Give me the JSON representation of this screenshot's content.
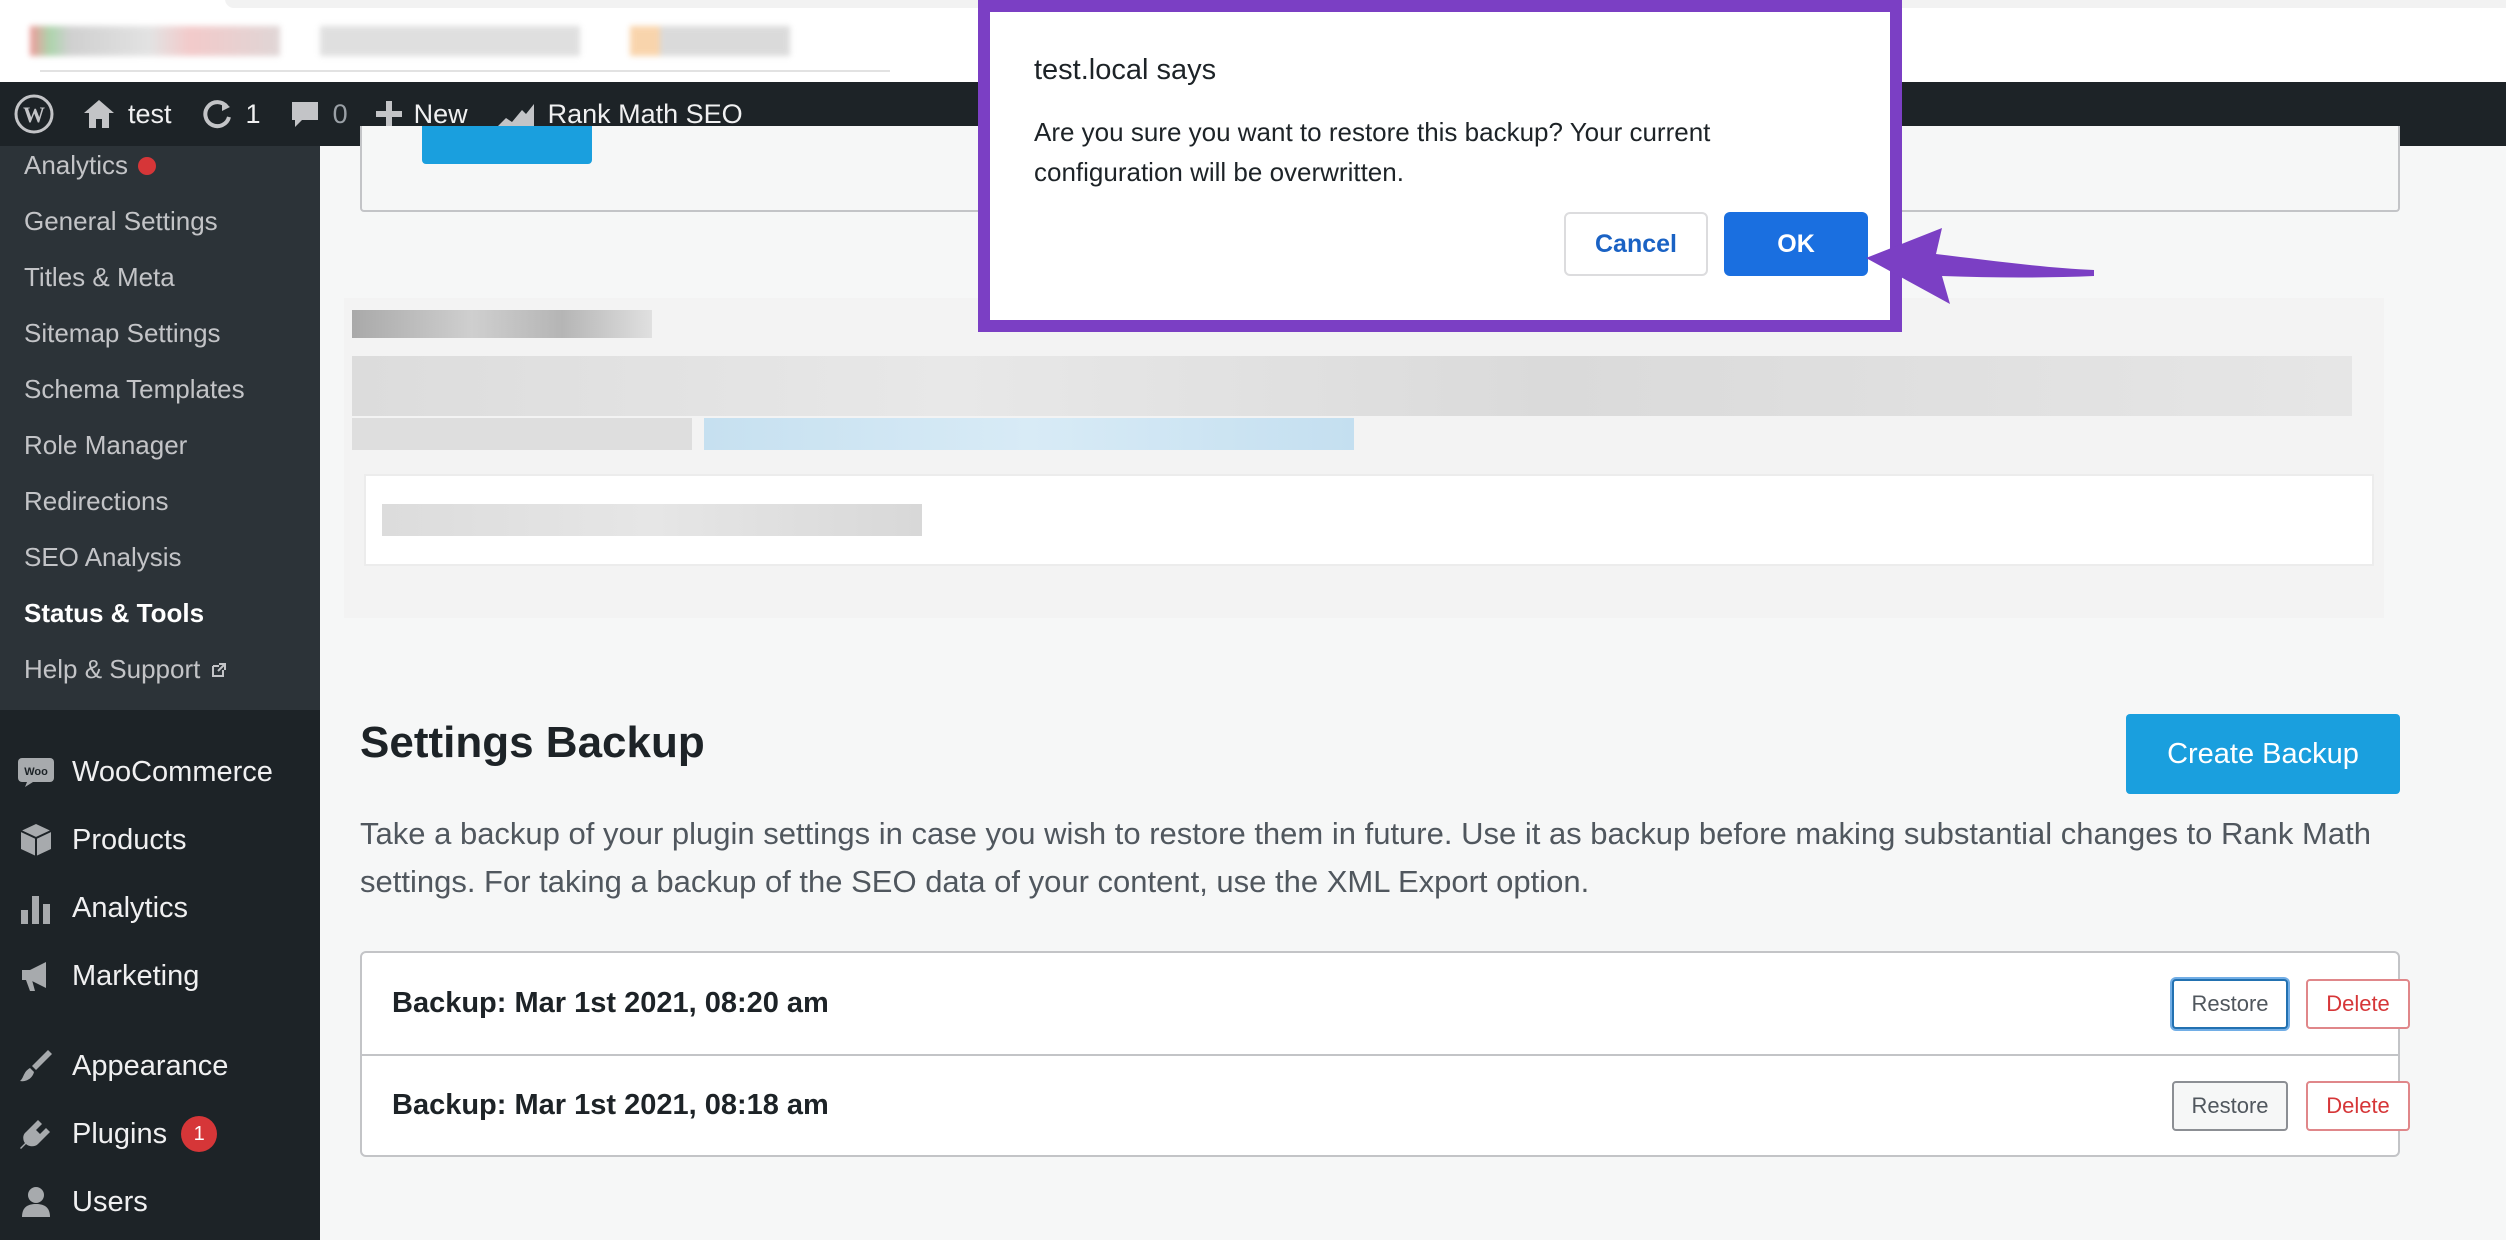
{
  "browser": {},
  "adminbar": {
    "site_name": "test",
    "updates_count": "1",
    "comments_count": "0",
    "new_label": "New",
    "rank_math_label": "Rank Math SEO"
  },
  "submenu": {
    "items": [
      {
        "label": "Analytics",
        "has_dot": true
      },
      {
        "label": "General Settings"
      },
      {
        "label": "Titles & Meta"
      },
      {
        "label": "Sitemap Settings"
      },
      {
        "label": "Schema Templates"
      },
      {
        "label": "Role Manager"
      },
      {
        "label": "Redirections"
      },
      {
        "label": "SEO Analysis"
      },
      {
        "label": "Status & Tools",
        "current": true
      },
      {
        "label": "Help & Support",
        "external": true
      }
    ]
  },
  "menu": {
    "items": [
      {
        "label": "WooCommerce",
        "icon": "woo-icon"
      },
      {
        "label": "Products",
        "icon": "box-icon"
      },
      {
        "label": "Analytics",
        "icon": "bar-chart-icon"
      },
      {
        "label": "Marketing",
        "icon": "megaphone-icon"
      },
      {
        "label": "Appearance",
        "icon": "brush-icon"
      },
      {
        "label": "Plugins",
        "icon": "plug-icon",
        "badge": "1"
      },
      {
        "label": "Users",
        "icon": "user-icon"
      }
    ]
  },
  "backup": {
    "title": "Settings Backup",
    "create_label": "Create Backup",
    "description": "Take a backup of your plugin settings in case you wish to restore them in future. Use it as backup before making substantial changes to Rank Math settings. For taking a backup of the SEO data of your content, use the XML Export option.",
    "rows": [
      {
        "label": "Backup: Mar 1st 2021, 08:20 am",
        "restore": "Restore",
        "delete": "Delete"
      },
      {
        "label": "Backup: Mar 1st 2021, 08:18 am",
        "restore": "Restore",
        "delete": "Delete"
      }
    ]
  },
  "dialog": {
    "title": "test.local says",
    "message": "Are you sure you want to restore this backup? Your current configuration will be overwritten.",
    "cancel_label": "Cancel",
    "ok_label": "OK"
  },
  "colors": {
    "accent": "#1a9fde",
    "dialog_border": "#7b3fc4",
    "admin_bg": "#1d2327",
    "delete_red": "#d63638"
  }
}
